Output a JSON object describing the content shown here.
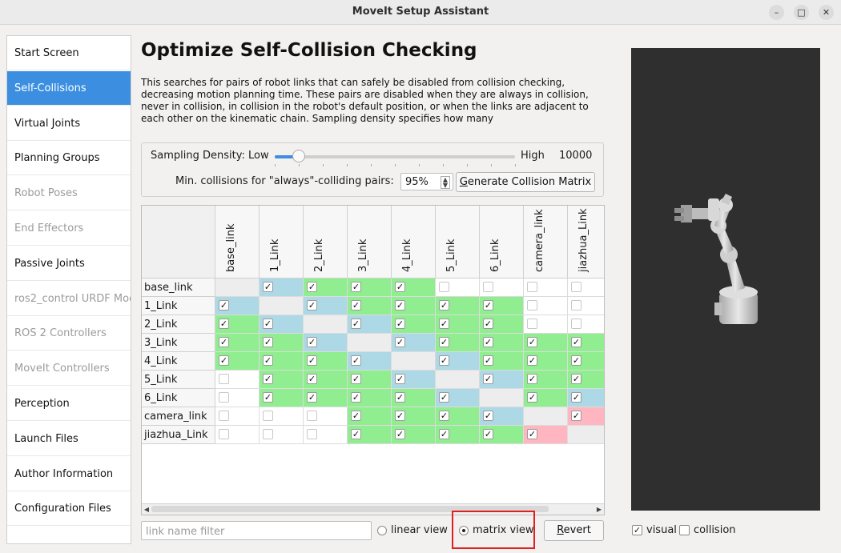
{
  "window": {
    "title": "MoveIt Setup Assistant"
  },
  "sidebar": {
    "items": [
      {
        "label": "Start Screen",
        "state": "normal"
      },
      {
        "label": "Self-Collisions",
        "state": "active"
      },
      {
        "label": "Virtual Joints",
        "state": "normal"
      },
      {
        "label": "Planning Groups",
        "state": "normal"
      },
      {
        "label": "Robot Poses",
        "state": "disabled"
      },
      {
        "label": "End Effectors",
        "state": "disabled"
      },
      {
        "label": "Passive Joints",
        "state": "normal"
      },
      {
        "label": "ros2_control URDF Mod",
        "state": "disabled"
      },
      {
        "label": "ROS 2 Controllers",
        "state": "disabled"
      },
      {
        "label": "MoveIt Controllers",
        "state": "disabled"
      },
      {
        "label": "Perception",
        "state": "normal"
      },
      {
        "label": "Launch Files",
        "state": "normal"
      },
      {
        "label": "Author Information",
        "state": "normal"
      },
      {
        "label": "Configuration Files",
        "state": "normal"
      }
    ]
  },
  "main": {
    "heading": "Optimize Self-Collision Checking",
    "description": "This searches for pairs of robot links that can safely be disabled from collision checking, decreasing motion planning time. These pairs are disabled when they are always in collision, never in collision, in collision in the robot's default position, or when the links are adjacent to each other on the kinematic chain. Sampling density specifies how many"
  },
  "density": {
    "label": "Sampling Density: Low",
    "high_label": "High",
    "value": "10000",
    "slider_fraction": 0.1,
    "min_collisions_label": "Min. collisions for \"always\"-colliding pairs:",
    "min_collisions_value": "95%",
    "generate_mnemonic": "G",
    "generate_rest": "enerate Collision Matrix"
  },
  "matrix": {
    "links": [
      "base_link",
      "1_Link",
      "2_Link",
      "3_Link",
      "4_Link",
      "5_Link",
      "6_Link",
      "camera_link",
      "jiazhua_Link"
    ],
    "cells": [
      [
        "gray:0",
        "blue:1",
        "green:1",
        "green:1",
        "green:1",
        "white:0",
        "white:0",
        "white:0",
        "white:0"
      ],
      [
        "blue:1",
        "gray:0",
        "blue:1",
        "green:1",
        "green:1",
        "green:1",
        "green:1",
        "white:0",
        "white:0"
      ],
      [
        "green:1",
        "blue:1",
        "gray:0",
        "blue:1",
        "green:1",
        "green:1",
        "green:1",
        "white:0",
        "white:0"
      ],
      [
        "green:1",
        "green:1",
        "blue:1",
        "gray:0",
        "blue:1",
        "green:1",
        "green:1",
        "green:1",
        "green:1"
      ],
      [
        "green:1",
        "green:1",
        "green:1",
        "blue:1",
        "gray:0",
        "blue:1",
        "green:1",
        "green:1",
        "green:1"
      ],
      [
        "white:0",
        "green:1",
        "green:1",
        "green:1",
        "blue:1",
        "gray:0",
        "blue:1",
        "green:1",
        "green:1"
      ],
      [
        "white:0",
        "green:1",
        "green:1",
        "green:1",
        "green:1",
        "blue:1",
        "gray:0",
        "green:1",
        "blue:1"
      ],
      [
        "white:0",
        "white:0",
        "white:0",
        "green:1",
        "green:1",
        "green:1",
        "blue:1",
        "gray:0",
        "pink:1"
      ],
      [
        "white:0",
        "white:0",
        "white:0",
        "green:1",
        "green:1",
        "green:1",
        "green:1",
        "pink:1",
        "gray:0"
      ]
    ],
    "colors": {
      "green": "#90ee90",
      "blue": "#add8e6",
      "pink": "#ffb6c1",
      "gray": "#ededed",
      "white": "#ffffff"
    }
  },
  "bottom": {
    "filter_placeholder": "link name filter",
    "linear_view_label": "linear view",
    "matrix_view_label": "matrix view",
    "selected_view": "matrix",
    "revert_mnemonic": "R",
    "revert_rest": "evert"
  },
  "viewer": {
    "visual_label": "visual",
    "visual_checked": true,
    "collision_label": "collision",
    "collision_checked": false
  },
  "icons": {
    "minimize": "minimize-icon",
    "maximize": "maximize-icon",
    "close": "close-icon"
  }
}
